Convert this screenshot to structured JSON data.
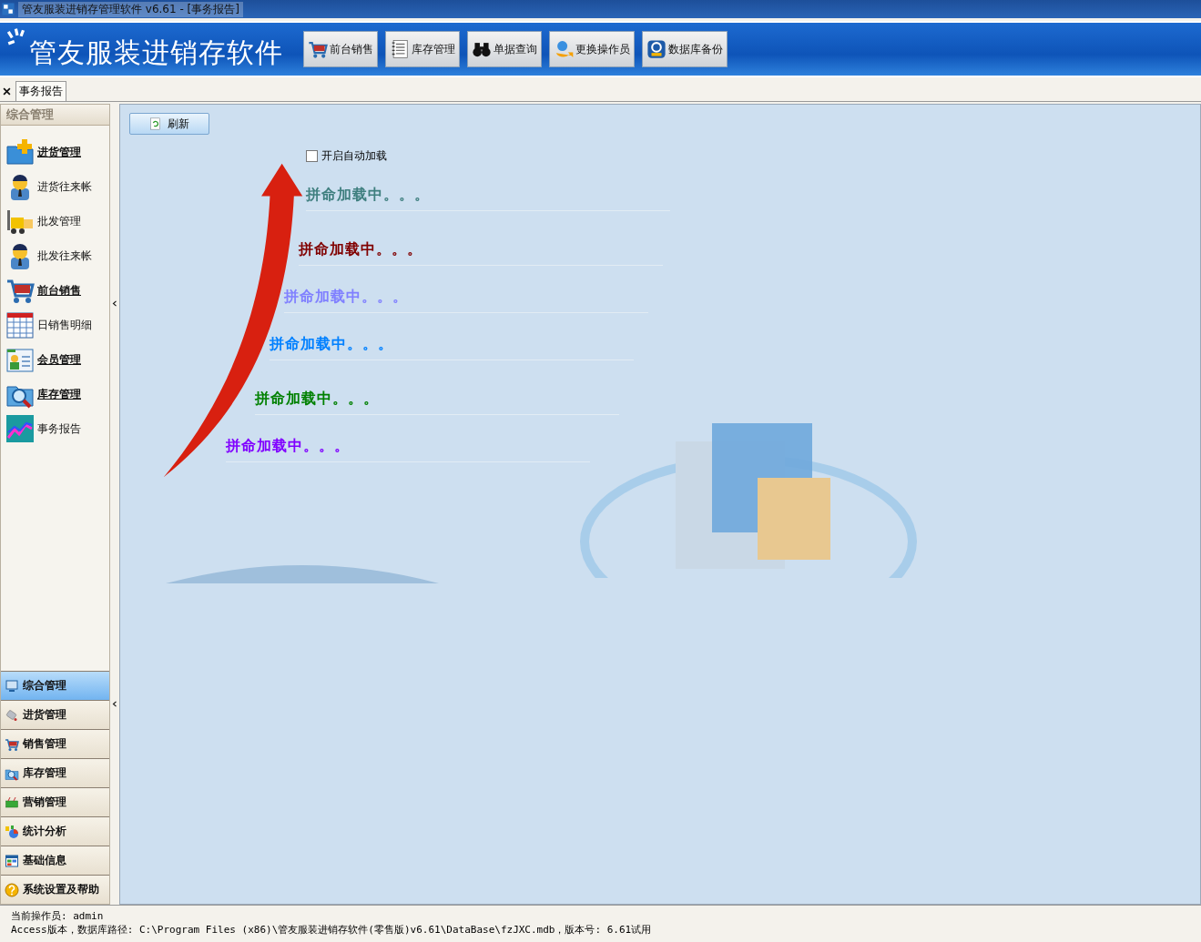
{
  "window": {
    "title": "管友服装进销存管理软件 v6.61 - [事务报告]"
  },
  "header": {
    "logo": "管友服装进销存软件",
    "toolbar": [
      {
        "label": "前台销售"
      },
      {
        "label": "库存管理"
      },
      {
        "label": "单据查询"
      },
      {
        "label": "更换操作员"
      },
      {
        "label": "数据库备份"
      }
    ]
  },
  "tabs": [
    {
      "label": "事务报告",
      "selected": true
    }
  ],
  "sidebar": {
    "title": "综合管理",
    "items": [
      {
        "label": "进货管理",
        "bold": true
      },
      {
        "label": "进货往来帐",
        "bold": false
      },
      {
        "label": "批发管理",
        "bold": false
      },
      {
        "label": "批发往来帐",
        "bold": false
      },
      {
        "label": "前台销售",
        "bold": true
      },
      {
        "label": "日销售明细",
        "bold": false
      },
      {
        "label": "会员管理",
        "bold": true
      },
      {
        "label": "库存管理",
        "bold": true
      },
      {
        "label": "事务报告",
        "bold": false
      }
    ],
    "sections": [
      {
        "label": "综合管理",
        "selected": true
      },
      {
        "label": "进货管理",
        "selected": false
      },
      {
        "label": "销售管理",
        "selected": false
      },
      {
        "label": "库存管理",
        "selected": false
      },
      {
        "label": "营销管理",
        "selected": false
      },
      {
        "label": "统计分析",
        "selected": false
      },
      {
        "label": "基础信息",
        "selected": false
      },
      {
        "label": "系统设置及帮助",
        "selected": false
      }
    ]
  },
  "content": {
    "refresh_button": "刷新",
    "auto_load": {
      "label": "开启自动加载",
      "checked": false
    },
    "loading_lines": [
      {
        "text": "拼命加载中。。。",
        "color": "#3f7f7f"
      },
      {
        "text": "拼命加载中。。。",
        "color": "#800000"
      },
      {
        "text": "拼命加载中。。。",
        "color": "#8080ff"
      },
      {
        "text": "拼命加载中。。。",
        "color": "#0080ff"
      },
      {
        "text": "拼命加载中。。。",
        "color": "#008000"
      },
      {
        "text": "拼命加载中。。。",
        "color": "#8000ff"
      }
    ]
  },
  "status_bar": {
    "lines": [
      "当前操作员: admin",
      "Access版本，数据库路径: C:\\Program Files (x86)\\管友服装进销存软件(零售版)v6.61\\DataBase\\fzJXC.mdb，版本号: 6.61试用"
    ]
  }
}
